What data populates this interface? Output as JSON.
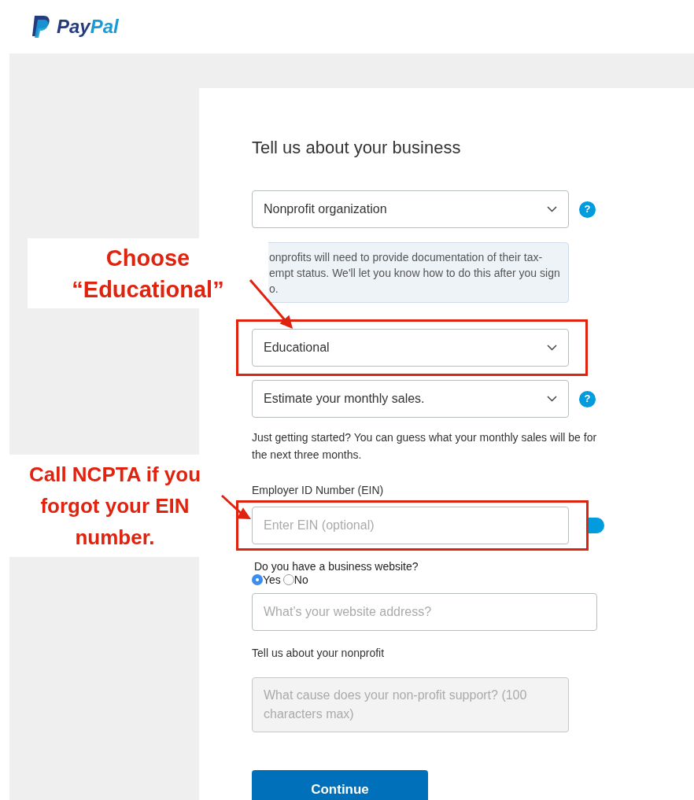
{
  "logo": {
    "parts": [
      "Pay",
      "Pal"
    ]
  },
  "title": "Tell us about your business",
  "business_type": {
    "value": "Nonprofit organization",
    "help": "?"
  },
  "info": "onprofits will need to provide documentation of their tax-\nempt status. We'll let you know how to do this after you sign\no.",
  "category": {
    "value": "Educational"
  },
  "sales": {
    "value": "Estimate your monthly sales.",
    "help": "?"
  },
  "sales_hint": "Just getting started? You can guess what your monthly sales will be for the next three months.",
  "ein": {
    "label": "Employer ID Number (EIN)",
    "placeholder": "Enter EIN (optional)"
  },
  "website": {
    "question": "Do you have a business website?",
    "options": [
      {
        "label": "Yes",
        "selected": true
      },
      {
        "label": "No",
        "selected": false
      }
    ],
    "placeholder": "What’s your website address?"
  },
  "nonprofit": {
    "label": "Tell us about your nonprofit",
    "placeholder": "What cause does your non-profit support? (100 characters max)",
    "disabled": true
  },
  "button": "Continue",
  "annotations": [
    {
      "text": "Choose\n“Educational”"
    },
    {
      "text": "Call NCPTA if you\nforgot your EIN\nnumber."
    }
  ]
}
